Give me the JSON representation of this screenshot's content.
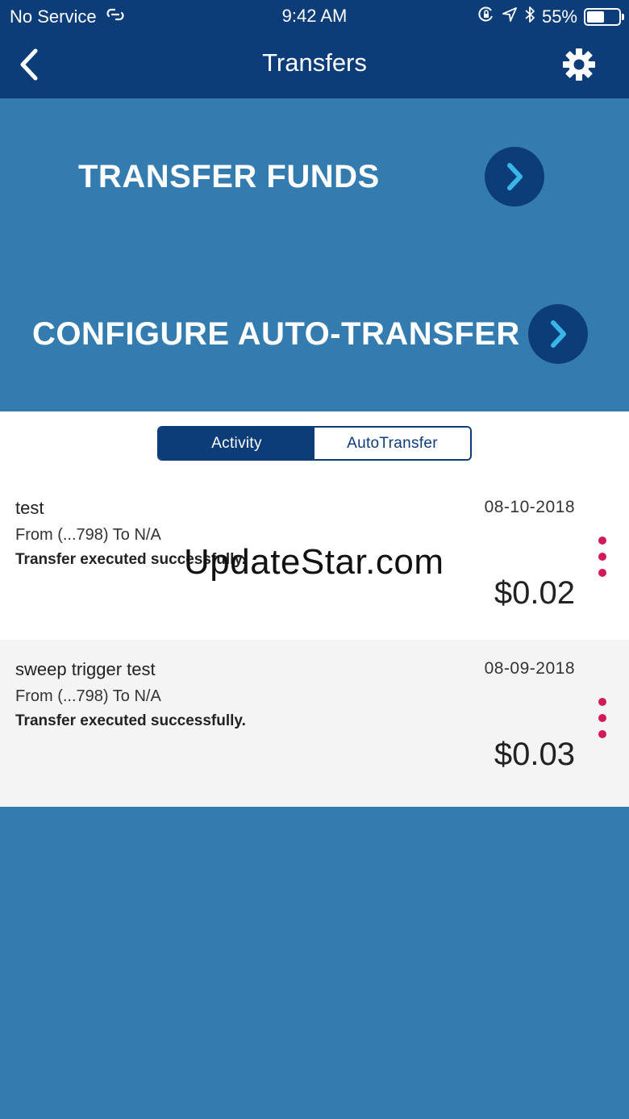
{
  "status_bar": {
    "carrier": "No Service",
    "time": "9:42 AM",
    "battery_percent": "55%",
    "battery_level": 0.55
  },
  "nav": {
    "title": "Transfers",
    "back_icon": "chevron-left-icon",
    "settings_icon": "gear-icon"
  },
  "actions": {
    "transfer_funds": "TRANSFER FUNDS",
    "configure_auto_transfer": "CONFIGURE AUTO-TRANSFER"
  },
  "tabs": {
    "activity": "Activity",
    "autotransfer": "AutoTransfer",
    "selected": "Activity"
  },
  "transactions": [
    {
      "name": "test",
      "from_to": "From (...798) To N/A",
      "status": "Transfer executed successfully.",
      "date": "08-10-2018",
      "amount": "$0.02"
    },
    {
      "name": "sweep trigger test",
      "from_to": "From (...798) To N/A",
      "status": "Transfer executed successfully.",
      "date": "08-09-2018",
      "amount": "$0.03"
    }
  ],
  "watermark": "UpdateStar.com",
  "colors": {
    "navy": "#0d3d78",
    "blue": "#347cb0",
    "accent_cyan": "#39b5e8",
    "kebab_pink": "#d2195c",
    "row_alt_bg": "#f4f4f4"
  }
}
